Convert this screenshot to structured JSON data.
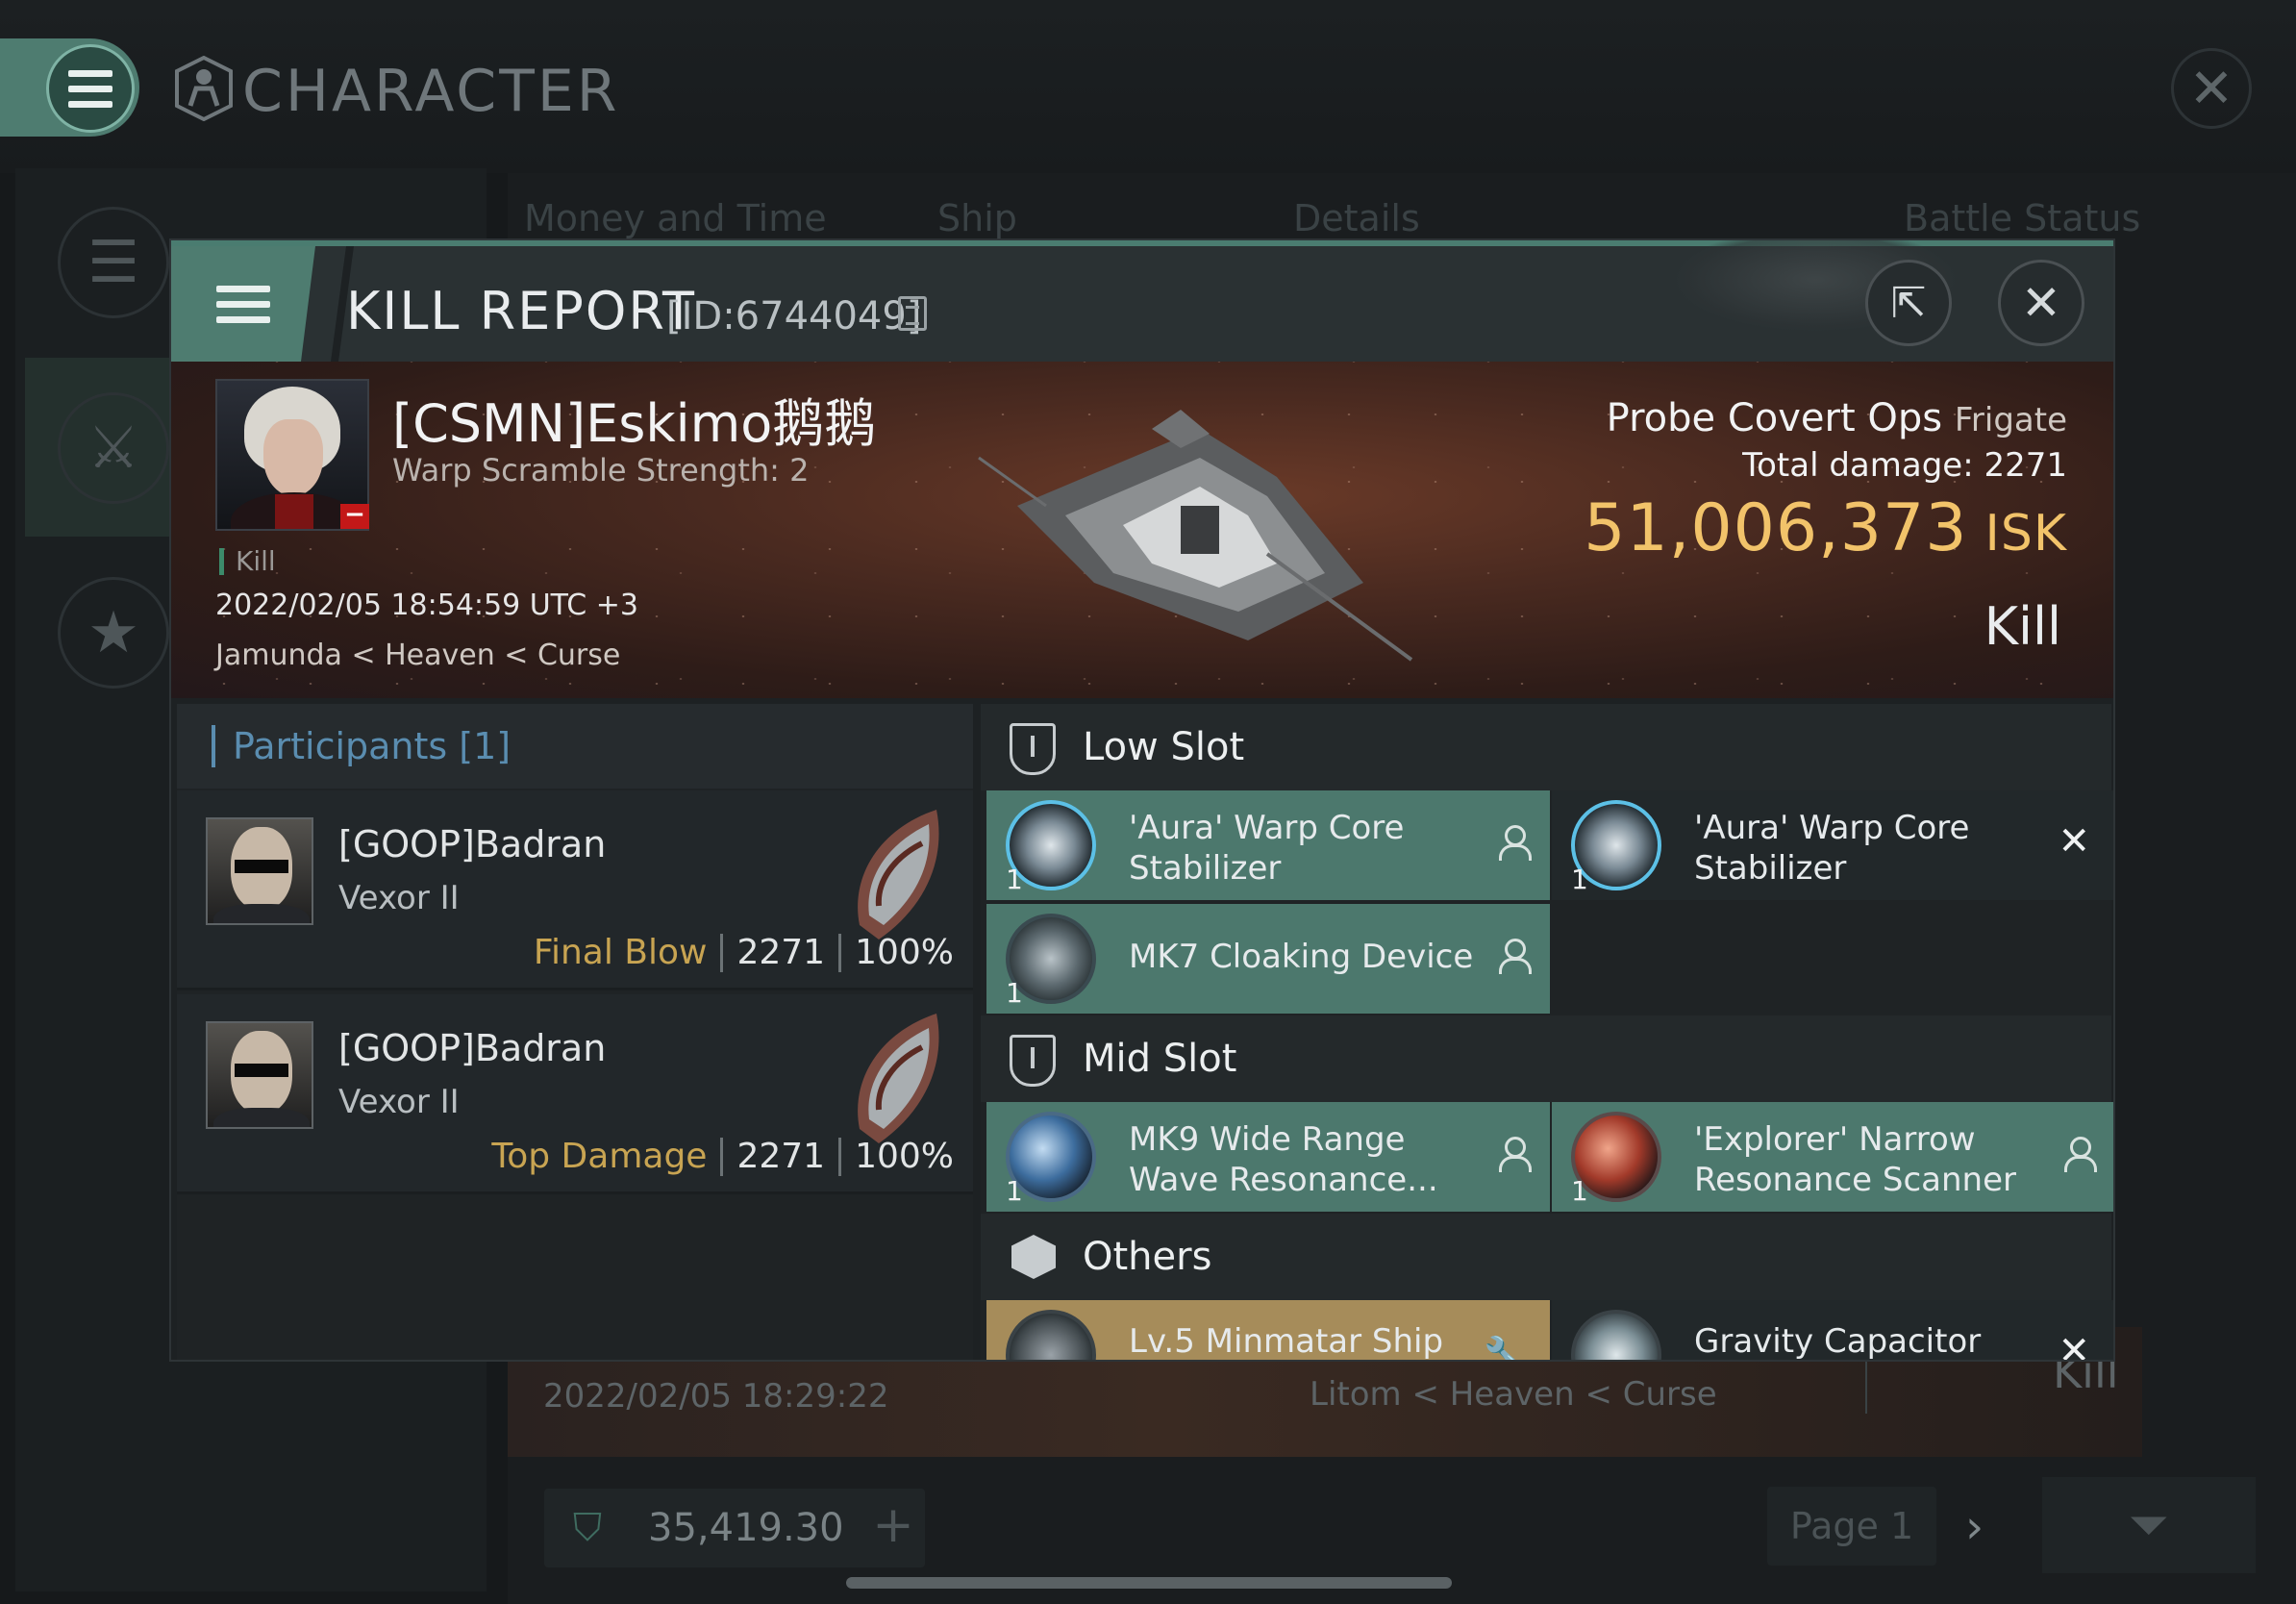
{
  "window": {
    "title": "CHARACTER",
    "close_icon": "close-icon"
  },
  "background_list": {
    "headers": [
      "Money and Time",
      "Ship",
      "Details",
      "Battle Status"
    ],
    "row": {
      "date": "2022/02/05 18:29:22",
      "location": "Litom < Heaven < Curse",
      "status": "Kill"
    },
    "wallet_value": "35,419.30",
    "page_label": "Page 1"
  },
  "kill_report": {
    "title": "KILL REPORT",
    "id": "[ID:6744049]",
    "victim": {
      "name": "[CSMN]Eskimo鹅鹅",
      "subtitle": "Warp Scramble Strength: 2",
      "tag": "Kill",
      "time": "2022/02/05 18:54:59 UTC +3",
      "location": "Jamunda < Heaven < Curse"
    },
    "ship": {
      "name": "Probe Covert Ops",
      "class": "Frigate",
      "total_damage_label": "Total damage:",
      "total_damage": "2271",
      "isk_value": "51,006,373",
      "isk_unit": "ISK",
      "result": "Kill"
    },
    "participants": {
      "title": "Participants [1]",
      "rows": [
        {
          "name": "[GOOP]Badran",
          "ship": "Vexor II",
          "label": "Final Blow",
          "damage": "2271",
          "percent": "100%"
        },
        {
          "name": "[GOOP]Badran",
          "ship": "Vexor II",
          "label": "Top Damage",
          "damage": "2271",
          "percent": "100%"
        }
      ]
    },
    "fitting": {
      "low_slot_title": "Low Slot",
      "mid_slot_title": "Mid Slot",
      "others_title": "Others",
      "low": [
        {
          "name": "'Aura' Warp Core Stabilizer",
          "qty": "1",
          "status": "fitted"
        },
        {
          "name": "'Aura' Warp Core Stabilizer",
          "qty": "1",
          "status": "destroyed"
        },
        {
          "name": "MK7 Cloaking Device",
          "qty": "1",
          "status": "fitted"
        }
      ],
      "mid": [
        {
          "name": "MK9 Wide Range Wave Resonance...",
          "qty": "1",
          "status": "fitted"
        },
        {
          "name": "'Explorer' Narrow Resonance Scanner",
          "qty": "1",
          "status": "fitted"
        }
      ],
      "others": [
        {
          "name": "Lv.5 Minmatar Ship",
          "status": "gold"
        },
        {
          "name": "Gravity Capacitor",
          "status": "destroyed"
        }
      ]
    }
  },
  "colors": {
    "accent_teal": "#4e7c70",
    "isk_gold": "#f2c36a",
    "participant_label": "#c8a452",
    "participants_title": "#5a8db0"
  }
}
